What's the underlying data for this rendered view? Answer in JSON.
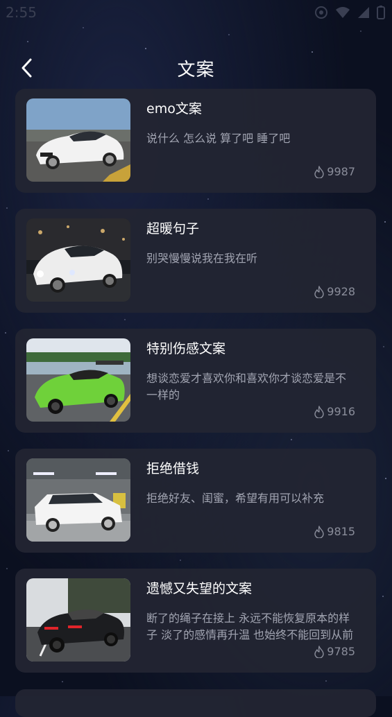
{
  "status_bar": {
    "time": "2:55"
  },
  "header": {
    "title": "文案"
  },
  "items": [
    {
      "title": "emo文案",
      "desc": "说什么 怎么说 算了吧 睡了吧",
      "count": "9987",
      "thumb": "white-lexus-car-image"
    },
    {
      "title": "超暖句子",
      "desc": "别哭慢慢说我在我在听",
      "count": "9928",
      "thumb": "white-infiniti-car-image"
    },
    {
      "title": "特别伤感文案",
      "desc": "想谈恋爱才喜欢你和喜欢你才谈恋爱是不一样的",
      "count": "9916",
      "thumb": "green-mazda-car-image"
    },
    {
      "title": "拒绝借钱",
      "desc": "拒绝好友、闺蜜，希望有用可以补充",
      "count": "9815",
      "thumb": "white-ae86-car-image"
    },
    {
      "title": "遗憾又失望的文案",
      "desc": "断了的绳子在接上 永远不能恢复原本的样子 淡了的感情再升温 也始终不能回到从前",
      "count": "9785",
      "thumb": "black-camaro-car-image"
    }
  ],
  "colors": {
    "card_bg": "#22242f",
    "title": "#ffffff",
    "desc": "#a2a5b2",
    "stat": "#8a8d9a"
  }
}
